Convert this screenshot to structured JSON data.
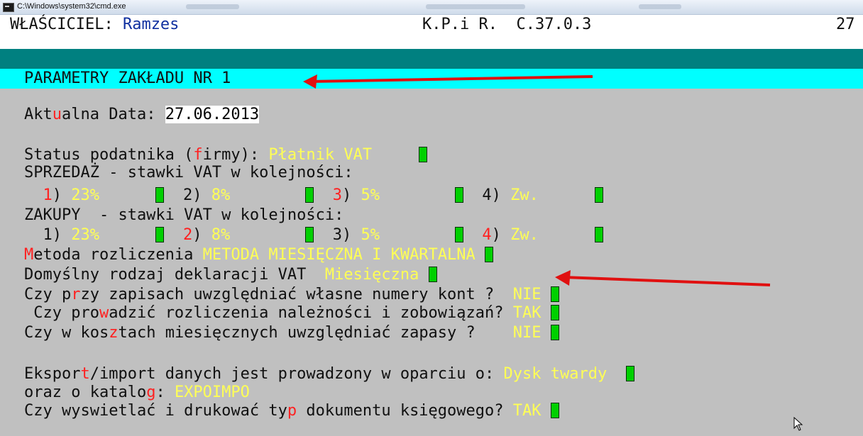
{
  "window": {
    "title": "C:\\Windows\\system32\\cmd.exe"
  },
  "header": {
    "owner_label": "WŁAŚCICIEL:",
    "owner_name": "Ramzes",
    "program": "K.P.i R.",
    "version": "C.37.0.3",
    "page_no": "27"
  },
  "section": {
    "title": "PARAMETRY ZAKŁADU NR 1"
  },
  "date": {
    "label_a": "Akt",
    "label_hot": "u",
    "label_b": "alna Data:",
    "value": "27.06.2013"
  },
  "status": {
    "label_a": "Status podatnika (",
    "label_hot": "f",
    "label_b": "irmy):",
    "value": "Płatnik VAT"
  },
  "sales": {
    "heading": "SPRZEDAŻ - stawki VAT w kolejności:",
    "rates": [
      {
        "num": "1",
        "value": "23%"
      },
      {
        "num": "2",
        "value": "8%"
      },
      {
        "num": "3",
        "value": "5%"
      },
      {
        "num": "4",
        "value": "Zw."
      }
    ]
  },
  "purchases": {
    "heading": "ZAKUPY  - stawki VAT w kolejności:",
    "rates": [
      {
        "num": "1",
        "value": "23%"
      },
      {
        "num": "2",
        "value": "8%"
      },
      {
        "num": "3",
        "value": "5%"
      },
      {
        "num": "4",
        "value": "Zw."
      }
    ]
  },
  "method": {
    "label_hot": "M",
    "label_b": "etoda rozliczenia",
    "value": "METODA MIESIĘCZNA I KWARTALNA"
  },
  "declaration": {
    "label": "Domyślny rodzaj deklaracji VAT",
    "value": "Miesięczna"
  },
  "accounts": {
    "label_a": "Czy p",
    "label_hot": "r",
    "label_b": "zy zapisach uwzględniać własne numery kont ?",
    "value": "NIE"
  },
  "receivables": {
    "label_a": " Czy pro",
    "label_hot": "w",
    "label_b": "adzić rozliczenia należności i zobowiązań?",
    "value": "TAK"
  },
  "stock": {
    "label_a": "Czy w kos",
    "label_hot": "z",
    "label_b": "tach miesięcznych uwzględniać zapasy ?",
    "value": "NIE"
  },
  "export": {
    "label_a": "Ekspor",
    "label_hot": "t",
    "label_b": "/import danych jest prowadzony w oparciu o:",
    "value": "Dysk twardy"
  },
  "catalog": {
    "label_a": "oraz o katalo",
    "label_hot": "g",
    "label_b": ":",
    "value": "EXPOIMPO"
  },
  "doctype": {
    "label_a": "Czy wyswietlać i drukować ty",
    "label_hot": "p",
    "label_b": " dokumentu księgowego?",
    "value": "TAK"
  },
  "colors": {
    "console_bg": "#c0c0c0",
    "highlight": "#ffff55",
    "hotkey": "#ff2020",
    "checkbox": "#00d000",
    "cyan_bar": "#00ffff",
    "teal_bar": "#008080",
    "arrow": "#e01010"
  }
}
